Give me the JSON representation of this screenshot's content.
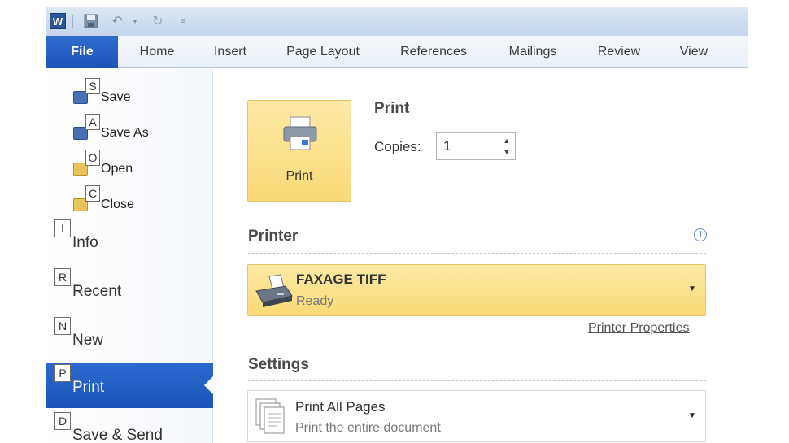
{
  "app": {
    "icon_letter": "W"
  },
  "quick_access": {
    "save_icon": "save-icon",
    "undo_icon": "undo-icon",
    "redo_icon": "redo-icon",
    "customize_icon": "customize-icon"
  },
  "ribbon": {
    "tabs": [
      {
        "label": "File",
        "active": true
      },
      {
        "label": "Home"
      },
      {
        "label": "Insert"
      },
      {
        "label": "Page Layout"
      },
      {
        "label": "References"
      },
      {
        "label": "Mailings"
      },
      {
        "label": "Review"
      },
      {
        "label": "View"
      }
    ]
  },
  "backstage": {
    "commands": [
      {
        "keytip": "S",
        "label": "Save",
        "icon": "save-icon"
      },
      {
        "keytip": "A",
        "label": "Save As",
        "icon": "save-as-icon"
      },
      {
        "keytip": "O",
        "label": "Open",
        "icon": "open-folder-icon"
      },
      {
        "keytip": "C",
        "label": "Close",
        "icon": "close-folder-icon"
      }
    ],
    "tabs": [
      {
        "keytip": "I",
        "label": "Info"
      },
      {
        "keytip": "R",
        "label": "Recent"
      },
      {
        "keytip": "N",
        "label": "New"
      },
      {
        "keytip": "P",
        "label": "Print",
        "selected": true
      },
      {
        "keytip": "D",
        "label": "Save & Send"
      }
    ]
  },
  "print_pane": {
    "print_button_label": "Print",
    "heading": "Print",
    "copies_label": "Copies:",
    "copies_value": "1",
    "printer": {
      "heading": "Printer",
      "name": "FAXAGE TIFF",
      "status": "Ready",
      "properties_link": "Printer Properties"
    },
    "settings": {
      "heading": "Settings",
      "pages_option": "Print All Pages",
      "pages_description": "Print the entire document"
    }
  },
  "colors": {
    "accent_blue": "#1d55b6",
    "highlight_yellow": "#fbd977"
  }
}
